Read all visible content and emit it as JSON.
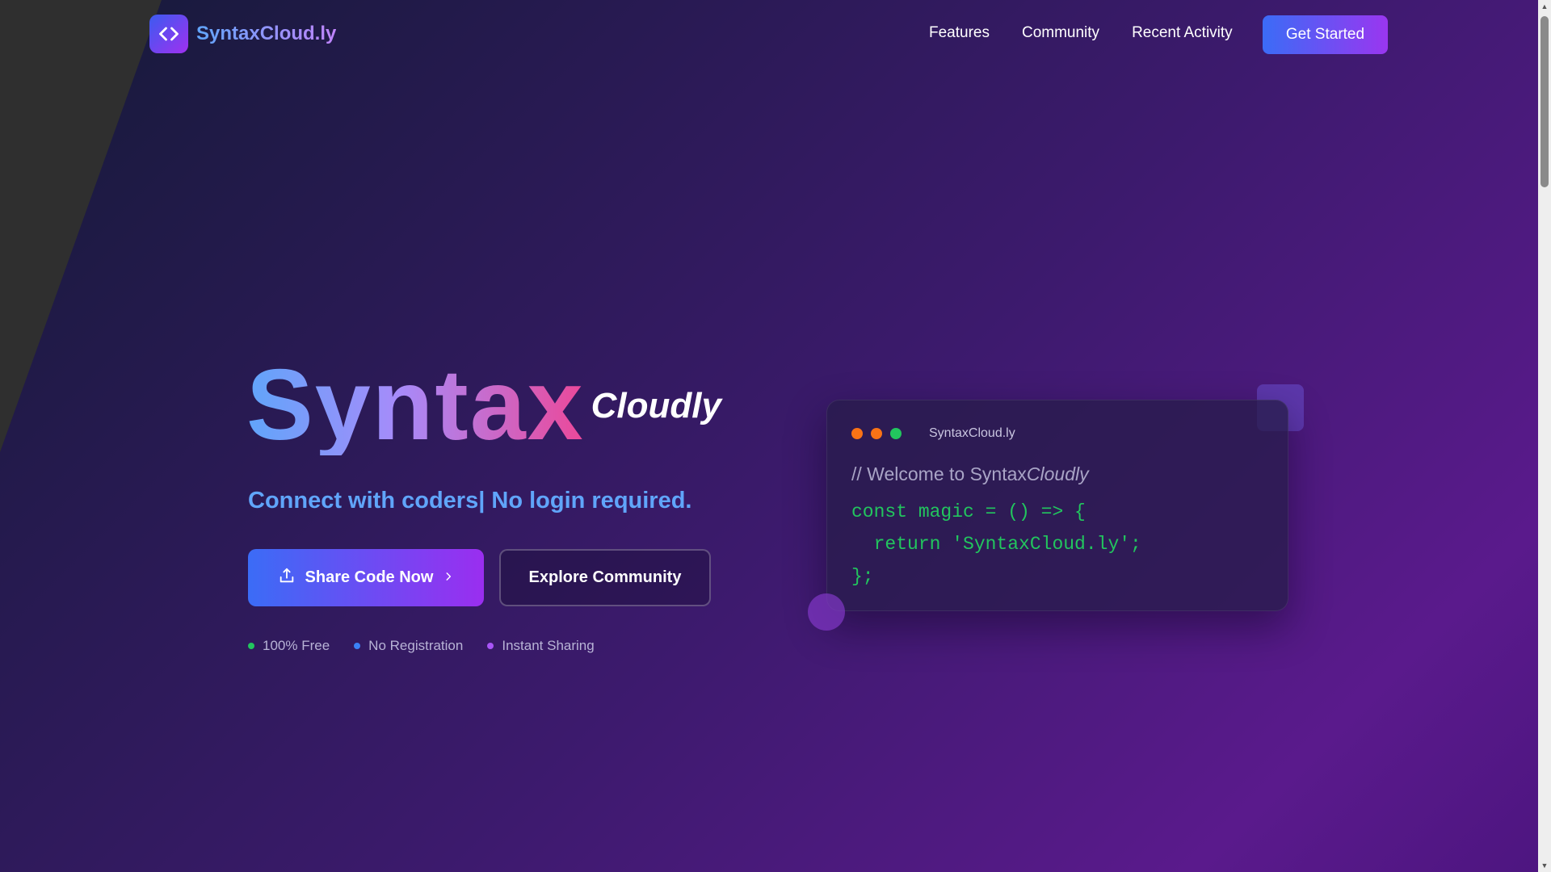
{
  "nav": {
    "brand": "SyntaxCloud.ly",
    "links": [
      "Features",
      "Community",
      "Recent Activity"
    ],
    "cta": "Get Started"
  },
  "hero": {
    "title_main": "Syntax",
    "title_super": "Cloudly",
    "tagline": "Connect with coders| No login required.",
    "primary_button": "Share Code Now",
    "secondary_button": "Explore Community",
    "features": [
      {
        "label": "100% Free",
        "color": "#22c55e"
      },
      {
        "label": "No Registration",
        "color": "#3b82f6"
      },
      {
        "label": "Instant Sharing",
        "color": "#a855f7"
      }
    ]
  },
  "code_card": {
    "title": "SyntaxCloud.ly",
    "comment_prefix": "// Welcome to Syntax",
    "comment_italic": "Cloudly",
    "lines": [
      "const magic = () => {",
      "  return 'SyntaxCloud.ly';",
      "};"
    ],
    "window_dots": [
      "#f97316",
      "#f97316",
      "#22c55e"
    ]
  },
  "icons": {
    "brand": "code-brackets-icon",
    "share": "upload-icon",
    "arrow": "chevron-right-icon"
  },
  "colors": {
    "accent_blue": "#3b6cf6",
    "accent_purple": "#9a2ef0",
    "tagline": "#60a5fa",
    "code_green": "#22c55e"
  }
}
